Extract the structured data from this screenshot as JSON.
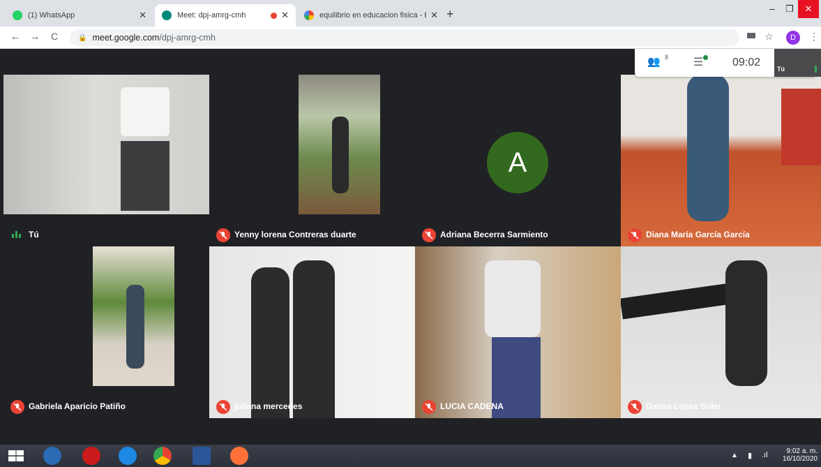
{
  "browser": {
    "tabs": [
      {
        "title": "(1) WhatsApp",
        "favicon": "whatsapp-icon",
        "color": "#25d366"
      },
      {
        "title": "Meet: dpj-amrg-cmh",
        "favicon": "meet-icon",
        "color": "#00897b",
        "recording_indicator": true
      },
      {
        "title": "equilibrio en educacion fisica - B",
        "favicon": "google-icon",
        "color": "#4285f4"
      }
    ],
    "new_tab_label": "+",
    "url_host": "meet.google.com",
    "url_path": "/dpj-amrg-cmh",
    "profile_initial": "D"
  },
  "meet": {
    "participants_count": "8",
    "time": "09:02",
    "self_label": "Tú",
    "tiles": [
      {
        "name": "Tú",
        "muted": false,
        "avatar_letter": ""
      },
      {
        "name": "Yenny lorena Contreras duarte",
        "muted": true,
        "avatar_letter": ""
      },
      {
        "name": "Adriana Becerra Sarmiento",
        "muted": true,
        "avatar_letter": "A"
      },
      {
        "name": "Diana María García García",
        "muted": true,
        "avatar_letter": ""
      },
      {
        "name": "Gabriela Aparicio Patiño",
        "muted": true,
        "avatar_letter": ""
      },
      {
        "name": "juliana mercedes",
        "muted": true,
        "avatar_letter": ""
      },
      {
        "name": "LUCIA CADENA",
        "muted": true,
        "avatar_letter": ""
      },
      {
        "name": "Danna López Soler",
        "muted": true,
        "avatar_letter": ""
      }
    ]
  },
  "taskbar": {
    "clock_time": "9:02 a. m.",
    "clock_date": "16/10/2020"
  },
  "colors": {
    "accent": "#ea4335",
    "avatar_green": "#33691e"
  }
}
